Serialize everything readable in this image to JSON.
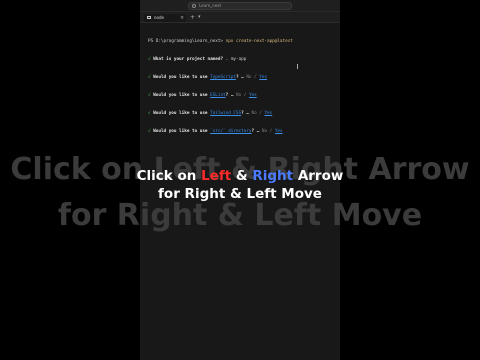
{
  "window": {
    "search_text": "Learn_next"
  },
  "tab": {
    "label": "node",
    "close": "×",
    "add": "+",
    "dropdown": "▾"
  },
  "terminal": {
    "prompt": "PS D:\\programming\\Learn_next> ",
    "command": "npx create-next-app@latest",
    "lines": [
      {
        "check": "√",
        "question": "What is your project named?",
        "sep": " … ",
        "answer": "my-app"
      },
      {
        "check": "√",
        "question": "Would you like to use ",
        "highlight": "TypeScript",
        "rest": "? … ",
        "no": "No",
        "slash": " / ",
        "yes": "Yes"
      },
      {
        "check": "√",
        "question": "Would you like to use ",
        "highlight": "ESLint",
        "rest": "? … ",
        "no": "No",
        "slash": " / ",
        "yes": "Yes"
      },
      {
        "check": "√",
        "question": "Would you like to use ",
        "highlight": "Tailwind CSS",
        "rest": "? … ",
        "no": "No",
        "slash": " / ",
        "yes": "Yes"
      },
      {
        "check": "√",
        "question": "Would you like to use ",
        "highlight": "`src/` directory",
        "rest": "? … ",
        "no": "No",
        "slash": " / ",
        "yes": "Yes"
      }
    ]
  },
  "overlay": {
    "ghost_line1": "Click on Left & Right Arrow",
    "ghost_line2": "for Right & Left Move",
    "caption_line1_a": "Click on ",
    "caption_line1_left": "Left",
    "caption_line1_amp": " & ",
    "caption_line1_right": "Right",
    "caption_line1_b": " Arrow",
    "caption_line2": "for Right & Left Move",
    "colors": {
      "left": "#ff2b2b",
      "right": "#4b7bff"
    }
  }
}
